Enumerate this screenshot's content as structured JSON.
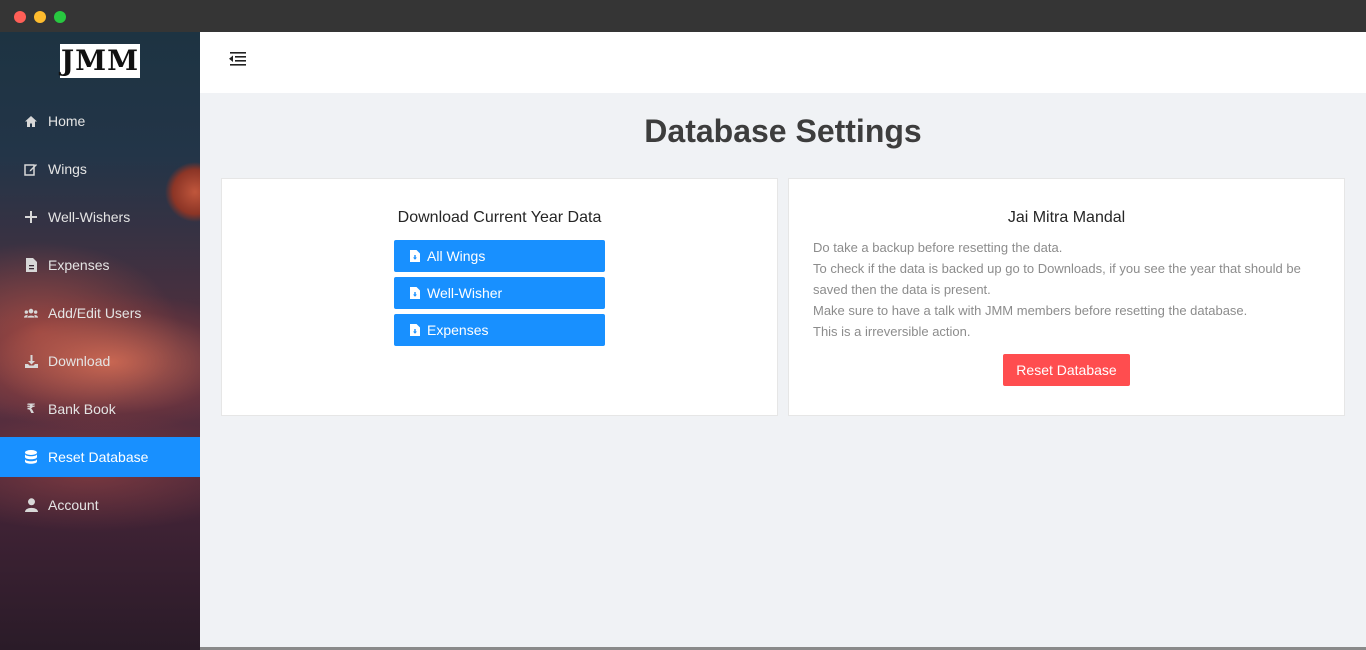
{
  "logo": {
    "text": "JMM",
    "subtext": "Jai Mitra Mandal"
  },
  "sidebar": {
    "items": [
      {
        "label": "Home",
        "icon": "home-icon"
      },
      {
        "label": "Wings",
        "icon": "edit-icon"
      },
      {
        "label": "Well-Wishers",
        "icon": "plus-icon"
      },
      {
        "label": "Expenses",
        "icon": "file-invoice-icon"
      },
      {
        "label": "Add/Edit Users",
        "icon": "users-icon"
      },
      {
        "label": "Download",
        "icon": "download-icon"
      },
      {
        "label": "Bank Book",
        "icon": "rupee-icon"
      },
      {
        "label": "Reset Database",
        "icon": "database-icon",
        "active": true
      },
      {
        "label": "Account",
        "icon": "user-icon"
      }
    ]
  },
  "page": {
    "title": "Database Settings"
  },
  "download_card": {
    "heading": "Download Current Year Data",
    "buttons": [
      "All Wings",
      "Well-Wisher",
      "Expenses"
    ]
  },
  "reset_card": {
    "heading": "Jai Mitra Mandal",
    "lines": [
      "Do take a backup before resetting the data.",
      "To check if the data is backed up go to Downloads, if you see the year that should be saved then the data is present.",
      "Make sure to have a talk with JMM members before resetting the database.",
      "This is a irreversible action."
    ],
    "button": "Reset Database"
  },
  "colors": {
    "primary": "#1890ff",
    "danger": "#ff4d4f",
    "background": "#f0f2f5"
  }
}
